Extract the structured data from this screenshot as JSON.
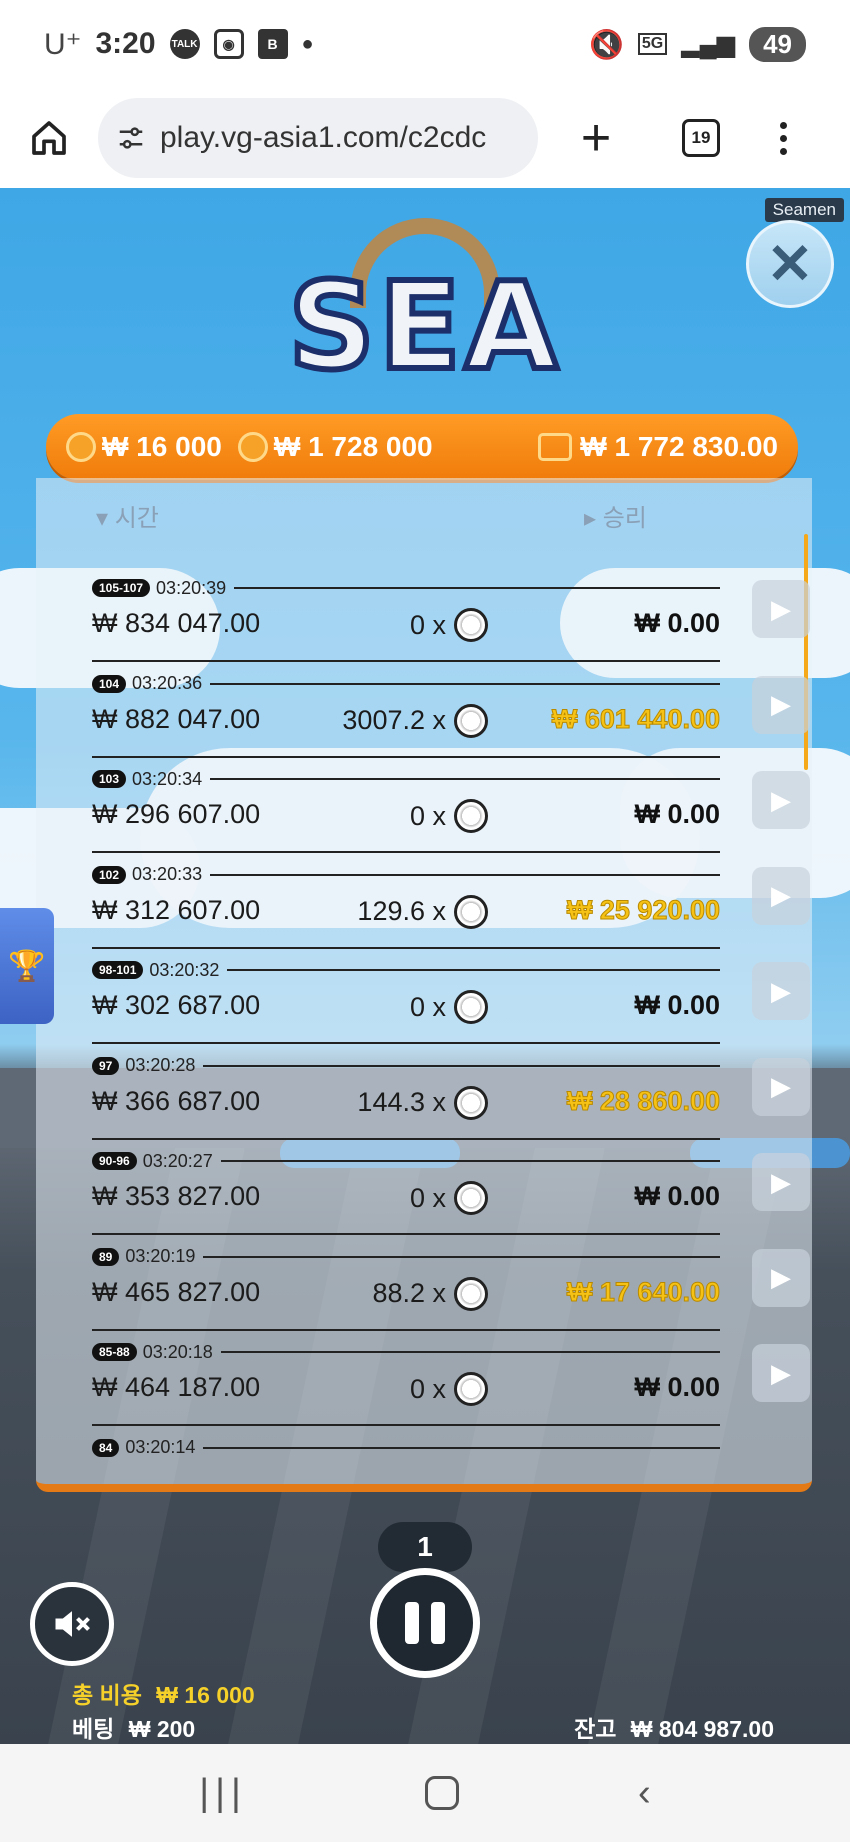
{
  "status": {
    "carrier": "U⁺",
    "time": "3:20",
    "talk": "TALK",
    "battery": "49",
    "network": "5G"
  },
  "browser": {
    "url": "play.vg-asia1.com/c2cdc",
    "tab_count": "19"
  },
  "game": {
    "provider": "Seamen",
    "logo": "SEA",
    "header": {
      "total_bet": "₩ 16 000",
      "total_win": "₩ 1 728 000",
      "wallet": "₩ 1 772 830.00"
    },
    "history": {
      "sort_time": "시간",
      "sort_win": "승리",
      "rows": [
        {
          "round": "105-107",
          "time": "03:20:39",
          "balance": "₩ 834 047.00",
          "mult": "0 x",
          "win": "₩ 0.00",
          "highlight": false
        },
        {
          "round": "104",
          "time": "03:20:36",
          "balance": "₩ 882 047.00",
          "mult": "3007.2 x",
          "win": "₩ 601 440.00",
          "highlight": true
        },
        {
          "round": "103",
          "time": "03:20:34",
          "balance": "₩ 296 607.00",
          "mult": "0 x",
          "win": "₩ 0.00",
          "highlight": false
        },
        {
          "round": "102",
          "time": "03:20:33",
          "balance": "₩ 312 607.00",
          "mult": "129.6 x",
          "win": "₩ 25 920.00",
          "highlight": true
        },
        {
          "round": "98-101",
          "time": "03:20:32",
          "balance": "₩ 302 687.00",
          "mult": "0 x",
          "win": "₩ 0.00",
          "highlight": false
        },
        {
          "round": "97",
          "time": "03:20:28",
          "balance": "₩ 366 687.00",
          "mult": "144.3 x",
          "win": "₩ 28 860.00",
          "highlight": true
        },
        {
          "round": "90-96",
          "time": "03:20:27",
          "balance": "₩ 353 827.00",
          "mult": "0 x",
          "win": "₩ 0.00",
          "highlight": false
        },
        {
          "round": "89",
          "time": "03:20:19",
          "balance": "₩ 465 827.00",
          "mult": "88.2 x",
          "win": "₩ 17 640.00",
          "highlight": true
        },
        {
          "round": "85-88",
          "time": "03:20:18",
          "balance": "₩ 464 187.00",
          "mult": "0 x",
          "win": "₩ 0.00",
          "highlight": false
        },
        {
          "round": "84",
          "time": "03:20:14",
          "balance": "",
          "mult": "",
          "win": "",
          "highlight": false
        }
      ]
    },
    "round_number": "1",
    "total_cost_label": "총 비용",
    "total_cost_value": "₩ 16 000",
    "bet_label": "베팅",
    "bet_value": "₩ 200",
    "balance_label": "잔고",
    "balance_value": "₩ 804 987.00"
  },
  "icons": {
    "home": "home-icon",
    "site_settings": "tune-icon",
    "new_tab": "plus-icon",
    "tabs": "tabs-icon",
    "menu": "more-vert-icon",
    "close": "close-icon",
    "trophy": "trophy-icon",
    "mute": "mute-icon",
    "pause": "pause-icon",
    "play": "play-icon",
    "coin": "coin-icon",
    "wallet": "wallet-icon"
  }
}
